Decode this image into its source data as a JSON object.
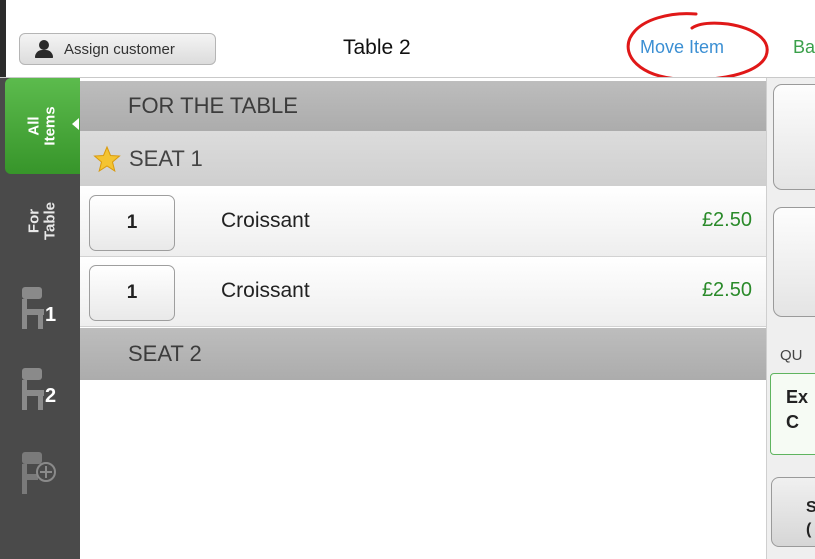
{
  "header": {
    "assign_customer_label": "Assign customer",
    "title": "Table 2",
    "move_item_label": "Move Item",
    "back_label_partial": "Ba"
  },
  "sidebar": {
    "all_items_label": "All\nItems",
    "for_table_label": "For\nTable",
    "seat_buttons": [
      {
        "icon": "chair-icon",
        "number": "1"
      },
      {
        "icon": "chair-icon",
        "number": "2"
      },
      {
        "icon": "add-seat-icon",
        "number": ""
      }
    ]
  },
  "sections": {
    "for_the_table": "FOR THE TABLE",
    "seat1": "SEAT 1",
    "seat2": "SEAT 2"
  },
  "items": [
    {
      "qty": "1",
      "name": "Croissant",
      "price": "£2.50"
    },
    {
      "qty": "1",
      "name": "Croissant",
      "price": "£2.50"
    }
  ],
  "right_panel": {
    "qu_label": "QU",
    "ex_line1": "Ex",
    "ex_line2": "C",
    "s_line1": "S",
    "s_line2": "("
  },
  "colors": {
    "accent_green": "#3fa33a",
    "link_blue": "#3b8fd3",
    "price_green": "#2a8a2a",
    "annotation_red": "#e01818"
  }
}
